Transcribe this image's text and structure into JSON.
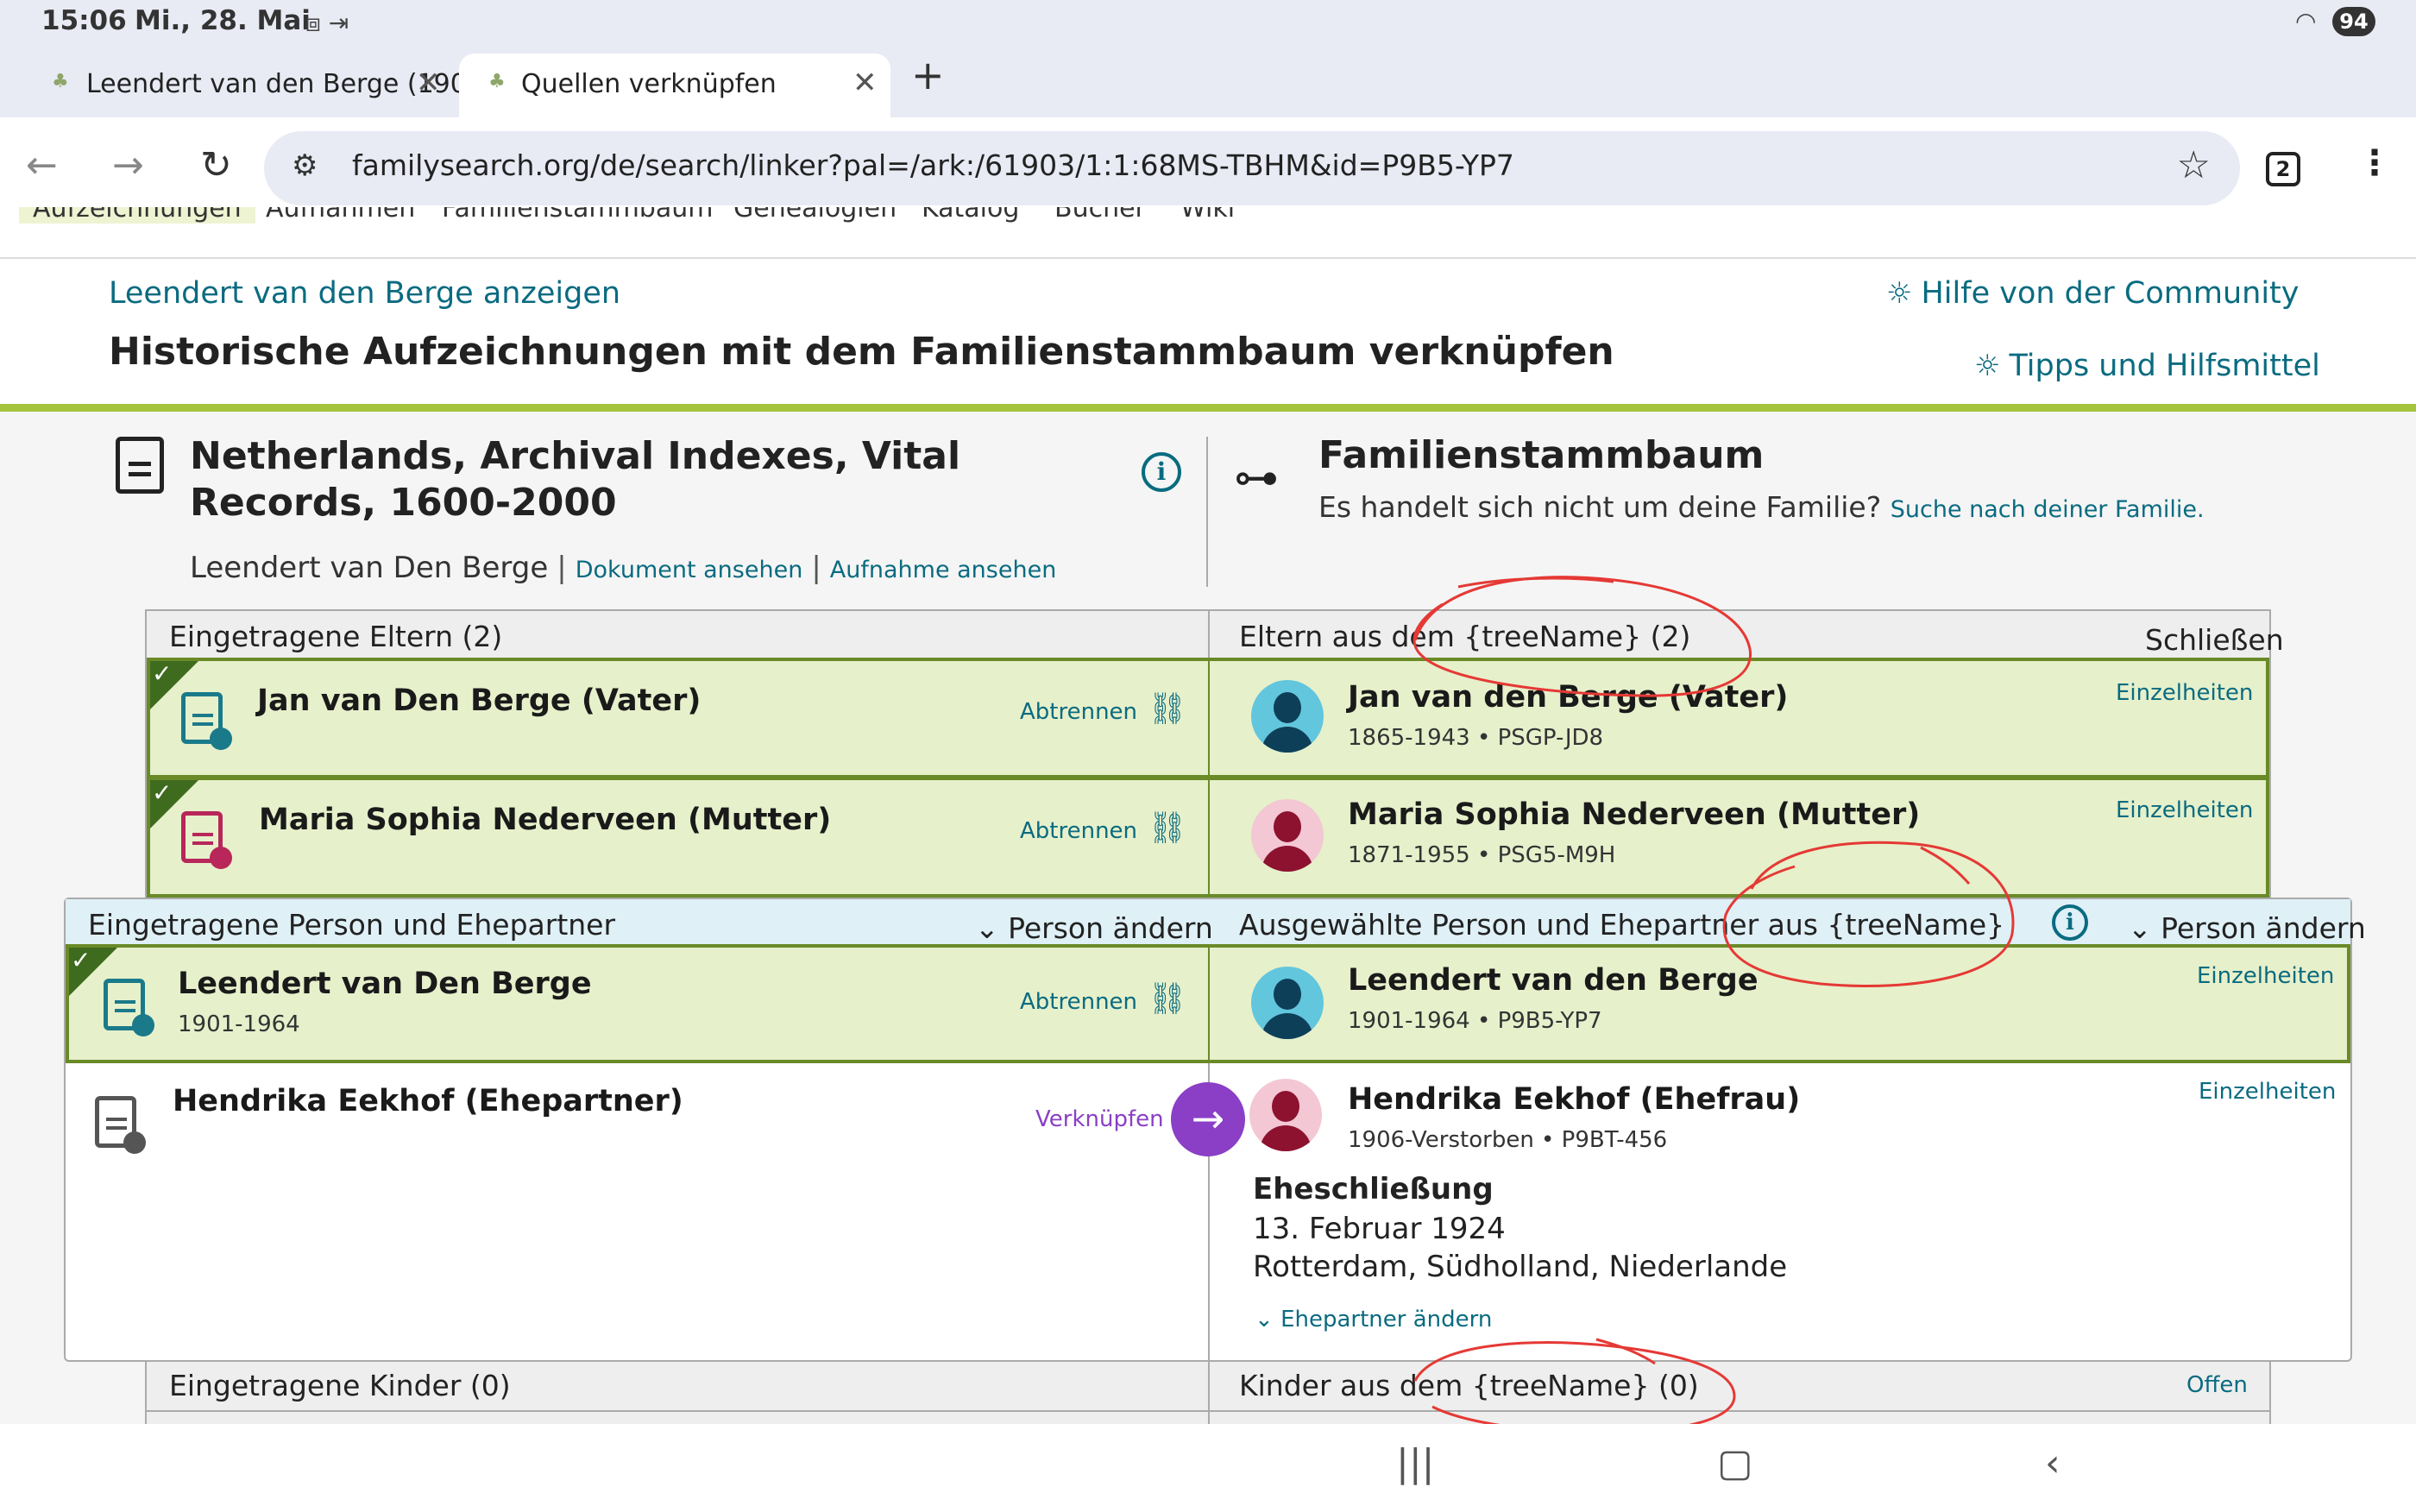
{
  "status_bar": {
    "time": "15:06",
    "date": "Mi., 28. Mai",
    "status_icons": "⧈ ⇥",
    "wifi_icon": "wifi-icon",
    "battery": "94"
  },
  "tabs": [
    {
      "label": "Leendert van den Berge (190",
      "close": "✕",
      "active": false
    },
    {
      "label": "Quellen verknüpfen",
      "close": "✕",
      "active": true
    }
  ],
  "new_tab": "+",
  "address_bar": {
    "url": "familysearch.org/de/search/linker?pal=/ark:/61903/1:1:68MS-TBHM&id=P9B5-YP7",
    "tab_count": "2"
  },
  "site_nav": [
    "Aufzeichnungen",
    "Aufnahmen",
    "Familienstammbaum",
    "Genealogien",
    "Katalog",
    "Bücher",
    "Wiki"
  ],
  "header": {
    "back_link": "Leendert van den Berge anzeigen",
    "title": "Historische Aufzeichnungen mit dem Familienstammbaum verknüpfen",
    "help_community": "Hilfe von der Community",
    "tips": "Tipps und Hilfsmittel"
  },
  "record": {
    "collection_title": "Netherlands, Archival Indexes, Vital Records, 1600-2000",
    "person": "Leendert van Den Berge",
    "view_document": "Dokument ansehen",
    "view_image": "Aufnahme ansehen"
  },
  "tree": {
    "title": "Familienstammbaum",
    "question": "Es handelt sich nicht um deine Familie?",
    "search_link": "Suche nach deiner Familie."
  },
  "parents": {
    "left_header": "Eingetragene Eltern (2)",
    "right_header": "Eltern aus dem {treeName} (2)",
    "toggle": "Schließen",
    "rows": [
      {
        "record_name": "Jan van Den Berge (Vater)",
        "action": "Abtrennen",
        "tree_name": "Jan van den Berge (Vater)",
        "tree_meta": "1865-1943 • PSGP-JD8",
        "details": "Einzelheiten"
      },
      {
        "record_name": "Maria Sophia Nederveen (Mutter)",
        "action": "Abtrennen",
        "tree_name": "Maria Sophia Nederveen (Mutter)",
        "tree_meta": "1871-1955 • PSG5-M9H",
        "details": "Einzelheiten"
      }
    ]
  },
  "couple": {
    "left_header": "Eingetragene Person und Ehepartner",
    "left_action": "Person ändern",
    "right_header": "Ausgewählte Person und Ehepartner aus {treeName}",
    "right_action": "Person ändern",
    "principal": {
      "record_name": "Leendert van Den Berge",
      "record_meta": "1901-1964",
      "action": "Abtrennen",
      "tree_name": "Leendert van den Berge",
      "tree_meta": "1901-1964 • P9B5-YP7",
      "details": "Einzelheiten"
    },
    "spouse": {
      "record_name": "Hendrika Eekhof (Ehepartner)",
      "action": "Verknüpfen",
      "tree_name": "Hendrika Eekhof (Ehefrau)",
      "tree_meta": "1906-Verstorben • P9BT-456",
      "details": "Einzelheiten"
    },
    "marriage": {
      "label": "Eheschließung",
      "date": "13. Februar 1924",
      "place": "Rotterdam, Südholland, Niederlande",
      "change_spouse": "Ehepartner ändern"
    }
  },
  "children": {
    "left_header": "Eingetragene Kinder (0)",
    "right_header": "Kinder aus dem {treeName} (0)",
    "toggle": "Offen"
  },
  "colors": {
    "link": "#0a6b80",
    "green_accent": "#a4c43c",
    "linked_row": "#e6f0cb",
    "link_button": "#8a3fc6",
    "annotation": "#e53935"
  }
}
